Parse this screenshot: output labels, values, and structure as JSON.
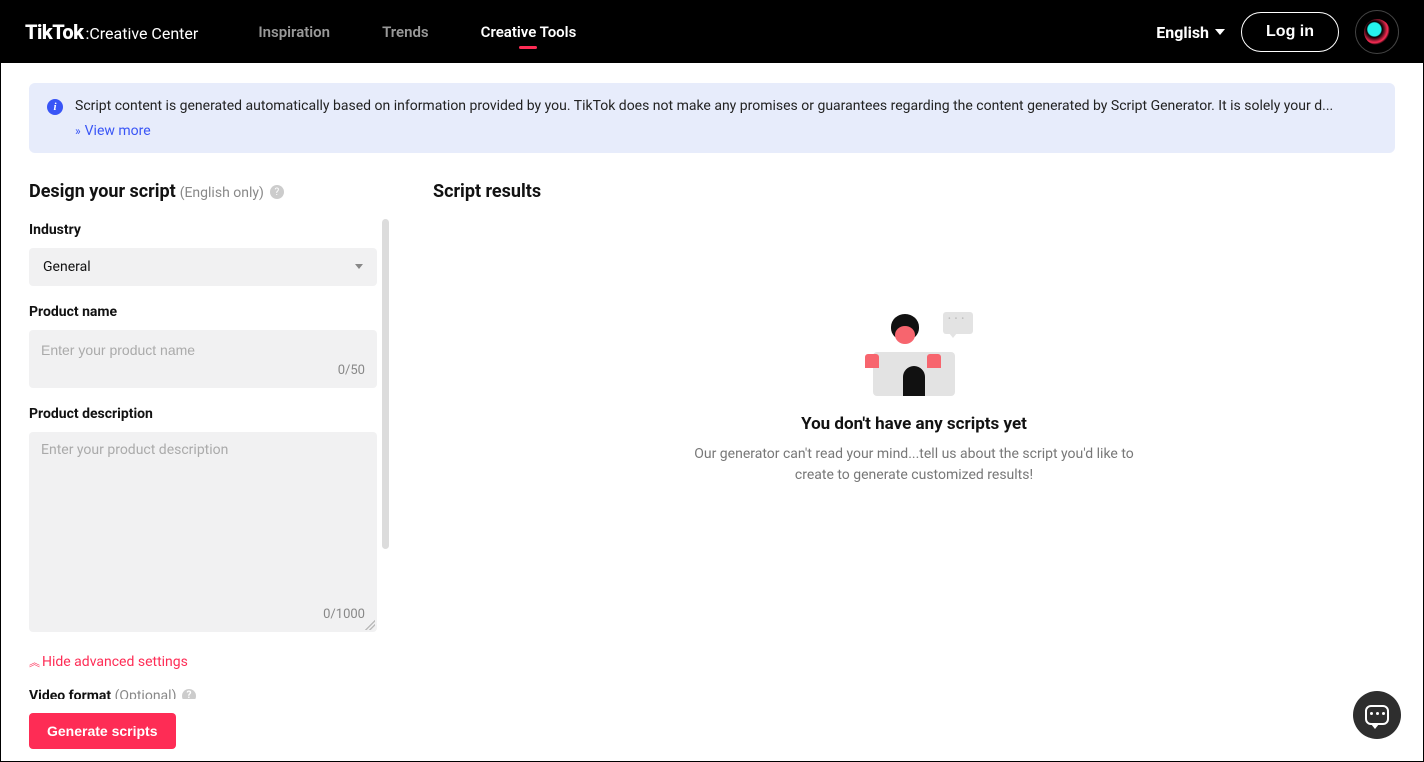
{
  "header": {
    "logo_main": "TikTok",
    "logo_sub": ":Creative Center",
    "nav": [
      "Inspiration",
      "Trends",
      "Creative Tools"
    ],
    "active_nav_index": 2,
    "language": "English",
    "login_label": "Log in"
  },
  "banner": {
    "text": "Script content is generated automatically based on information provided by you. TikTok does not make any promises or guarantees regarding the content generated by Script Generator. It is solely your d...",
    "view_more": "View more"
  },
  "form": {
    "title": "Design your script",
    "title_note": "(English only)",
    "industry_label": "Industry",
    "industry_value": "General",
    "product_name_label": "Product name",
    "product_name_placeholder": "Enter your product name",
    "product_name_count": "0/50",
    "product_desc_label": "Product description",
    "product_desc_placeholder": "Enter your product description",
    "product_desc_count": "0/1000",
    "hide_advanced": "Hide advanced settings",
    "video_format_label": "Video format",
    "optional": "(Optional)",
    "generate_label": "Generate scripts"
  },
  "results": {
    "title": "Script results",
    "empty_title": "You don't have any scripts yet",
    "empty_desc": "Our generator can't read your mind...tell us about the script you'd like to create to generate customized results!"
  }
}
